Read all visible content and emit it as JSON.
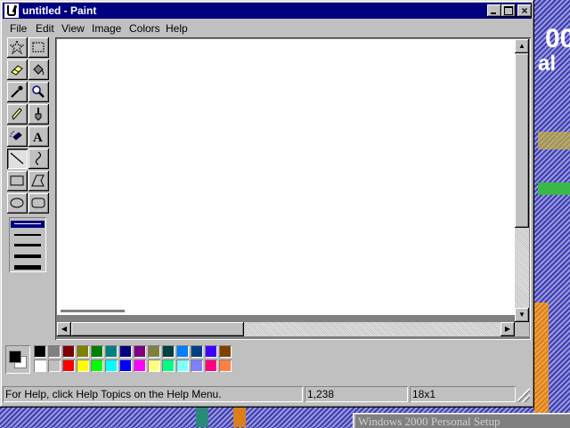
{
  "window": {
    "title": "untitled - Paint",
    "buttons": {
      "minimize": "minimize",
      "maximize": "maximize",
      "close": "×"
    }
  },
  "menu": [
    "File",
    "Edit",
    "View",
    "Image",
    "Colors",
    "Help"
  ],
  "tools": [
    {
      "name": "free-form-select-tool",
      "icon": "star-select-icon"
    },
    {
      "name": "select-tool",
      "icon": "dashed-rect-icon"
    },
    {
      "name": "eraser-tool",
      "icon": "eraser-icon"
    },
    {
      "name": "fill-tool",
      "icon": "paint-bucket-icon"
    },
    {
      "name": "pick-color-tool",
      "icon": "eyedropper-icon"
    },
    {
      "name": "magnifier-tool",
      "icon": "magnifier-icon"
    },
    {
      "name": "pencil-tool",
      "icon": "pencil-icon"
    },
    {
      "name": "brush-tool",
      "icon": "brush-icon"
    },
    {
      "name": "airbrush-tool",
      "icon": "airbrush-icon"
    },
    {
      "name": "text-tool",
      "icon": "text-a-icon"
    },
    {
      "name": "line-tool",
      "icon": "line-icon",
      "active": true
    },
    {
      "name": "curve-tool",
      "icon": "curve-icon"
    },
    {
      "name": "rectangle-tool",
      "icon": "rectangle-icon"
    },
    {
      "name": "polygon-tool",
      "icon": "polygon-icon"
    },
    {
      "name": "ellipse-tool",
      "icon": "ellipse-icon"
    },
    {
      "name": "rounded-rectangle-tool",
      "icon": "rounded-rect-icon"
    }
  ],
  "text_tool_glyph": "A",
  "line_widths": {
    "count": 5,
    "selected_index": 0
  },
  "palette": {
    "foreground": "#000000",
    "background": "#ffffff",
    "top_row": [
      "#000000",
      "#808080",
      "#800000",
      "#808000",
      "#008000",
      "#008080",
      "#000080",
      "#800080",
      "#808040",
      "#004040",
      "#0080ff",
      "#004080",
      "#4000ff",
      "#804000"
    ],
    "bottom_row": [
      "#ffffff",
      "#c0c0c0",
      "#ff0000",
      "#ffff00",
      "#00ff00",
      "#00ffff",
      "#0000ff",
      "#ff00ff",
      "#ffff80",
      "#00ff80",
      "#80ffff",
      "#8080ff",
      "#ff0080",
      "#ff8040"
    ]
  },
  "status": {
    "help_text": "For Help, click Help Topics on the Help Menu.",
    "coordinates": "1,238",
    "size": "18x1"
  },
  "desktop": {
    "background_fragments": [
      "00",
      "al"
    ],
    "setup_window_title": "Windows 2000 Personal Setup"
  }
}
